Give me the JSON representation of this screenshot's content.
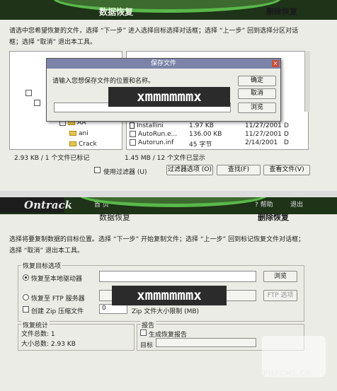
{
  "s1": {
    "header_title": "数据恢复",
    "header_right": "删除恢复",
    "instruction": "请选中您希望恢复的文件，选择 “下一步” 进入选择目标选择对话框；选择 “上一步” 回到选择分区对话框；选择 “取消” 退出本工具。",
    "tree": {
      "folder_aa": "AA",
      "folder_ani": "ani",
      "folder_crack": "Crack"
    },
    "files": [
      {
        "name": "Installini",
        "size": "1.97 KB",
        "date": "11/27/2001",
        "attr": "D"
      },
      {
        "name": "AutoRun.e...",
        "size": "136.00 KB",
        "date": "11/27/2001",
        "attr": "D"
      },
      {
        "name": "Autorun.inf",
        "size": "45 字节",
        "date": "2/14/2001",
        "attr": "D"
      }
    ],
    "left_status": "2.93 KB / 1 个文件已标记",
    "right_status": "1.45 MB / 12 个文件已显示",
    "use_filter": "使用过滤器 (U)",
    "btn_filter_options": "过滤器选项 (O)",
    "btn_find": "查找(F)",
    "btn_view_file": "查看文件(V)"
  },
  "dialog": {
    "title": "保存文件",
    "prompt": "请输入您想保存文件的位置和名称。",
    "path_value": "",
    "btn_ok": "确定",
    "btn_cancel": "取消",
    "btn_browse": "浏览"
  },
  "watermark1": "xmmmmmmx",
  "s2": {
    "logo": "Ontrack",
    "nav_home": "首 页",
    "nav_help": "? 帮助",
    "nav_exit": "退出",
    "header_title": "数据恢复",
    "header_right": "删除恢复",
    "instruction": "选择将要复制数据的目标位置。选择 “下一步” 开始复制文件；选择 “上一步” 回到标记恢复文件对话框；选择 “取消” 退出本工具。",
    "group_title": "恢复目标选项",
    "opt_local": "恢复至本地驱动器",
    "btn_browse": "浏览",
    "opt_ftp": "恢复至 FTP 服务器",
    "btn_ftp_options": "FTP 选项",
    "opt_zip": "创建 Zip 压缩文件",
    "zip_limit_value": "0",
    "zip_limit_label": "Zip 文件大小限制 (MB)",
    "stats_title": "恢复统计",
    "stats_files": "文件总数: 1",
    "stats_size": "大小总数: 2.93 KB",
    "report_title": "报告",
    "gen_report": "生成恢复报告",
    "target_label": "目标"
  },
  "watermark2": "xmmmmmmx",
  "brand_watermark": "PHPCMS.CN"
}
